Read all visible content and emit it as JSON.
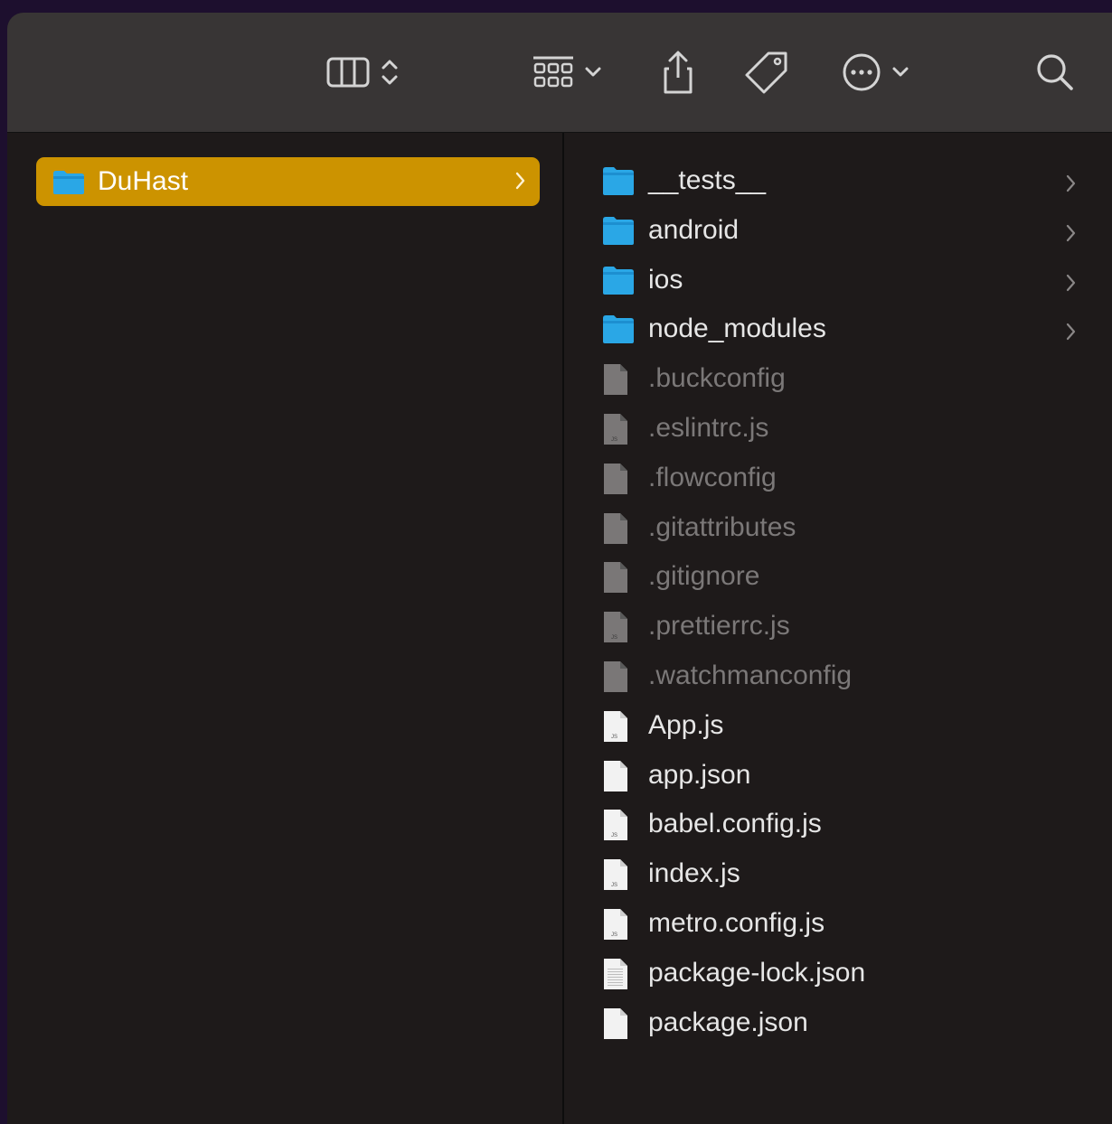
{
  "toolbar": {
    "buttons": [
      {
        "name": "column-view-button",
        "icon": "columns-icon",
        "menu": true
      },
      {
        "name": "group-button",
        "icon": "grid-icon",
        "menu": true
      },
      {
        "name": "share-button",
        "icon": "share-icon",
        "menu": false
      },
      {
        "name": "tag-button",
        "icon": "tag-icon",
        "menu": false
      },
      {
        "name": "more-button",
        "icon": "ellipsis-icon",
        "menu": true
      },
      {
        "name": "search-button",
        "icon": "search-icon",
        "menu": false
      }
    ]
  },
  "column1": {
    "items": [
      {
        "label": "DuHast",
        "kind": "folder",
        "selected": true
      }
    ]
  },
  "column2": {
    "items": [
      {
        "label": "__tests__",
        "kind": "folder"
      },
      {
        "label": "android",
        "kind": "folder"
      },
      {
        "label": "ios",
        "kind": "folder"
      },
      {
        "label": "node_modules",
        "kind": "folder"
      },
      {
        "label": ".buckconfig",
        "kind": "file",
        "hidden": true
      },
      {
        "label": ".eslintrc.js",
        "kind": "js",
        "hidden": true
      },
      {
        "label": ".flowconfig",
        "kind": "file",
        "hidden": true
      },
      {
        "label": ".gitattributes",
        "kind": "file",
        "hidden": true
      },
      {
        "label": ".gitignore",
        "kind": "file",
        "hidden": true
      },
      {
        "label": ".prettierrc.js",
        "kind": "js",
        "hidden": true
      },
      {
        "label": ".watchmanconfig",
        "kind": "file",
        "hidden": true
      },
      {
        "label": "App.js",
        "kind": "js"
      },
      {
        "label": "app.json",
        "kind": "file"
      },
      {
        "label": "babel.config.js",
        "kind": "js"
      },
      {
        "label": "index.js",
        "kind": "js"
      },
      {
        "label": "metro.config.js",
        "kind": "js"
      },
      {
        "label": "package-lock.json",
        "kind": "text"
      },
      {
        "label": "package.json",
        "kind": "file"
      }
    ]
  },
  "colors": {
    "selection": "#cc9300",
    "folder": "#2aa7e6",
    "text": "#e6e6e6",
    "hidden_text": "#7b7878"
  }
}
